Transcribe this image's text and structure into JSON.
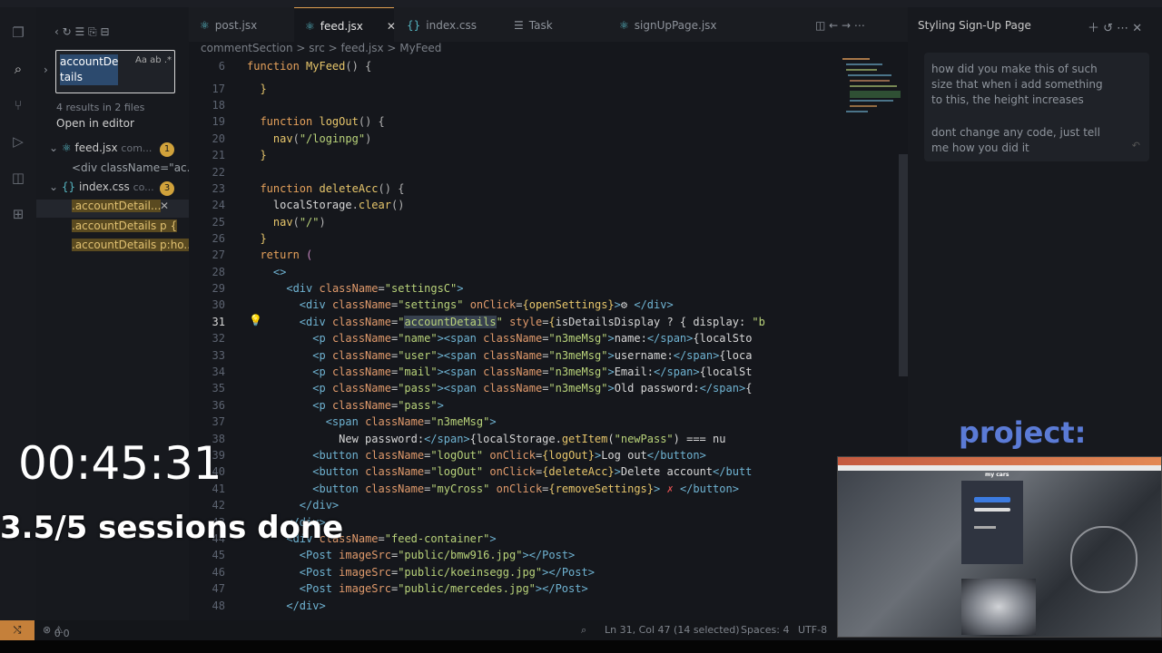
{
  "search": {
    "query_line1": "accountDe",
    "query_line2": "tails",
    "options": "Aa ab .*",
    "results_summary": "4 results in 2 files",
    "open_in_editor": "Open in editor",
    "files": [
      {
        "name": "feed.jsx",
        "path": "com...",
        "count": "1",
        "matches": [
          "<div className=\"ac..."
        ]
      },
      {
        "name": "index.css",
        "path": "co...",
        "count": "3",
        "matches": [
          ".accountDetail...",
          ".accountDetails p {",
          ".accountDetails p:ho..."
        ]
      }
    ]
  },
  "tabs": [
    {
      "label": "post.jsx",
      "active": false
    },
    {
      "label": "feed.jsx",
      "active": true
    },
    {
      "label": "index.css",
      "active": false
    },
    {
      "label": "Task",
      "active": false
    },
    {
      "label": "signUpPage.jsx",
      "active": false
    }
  ],
  "breadcrumb": "commentSection > src > feed.jsx > MyFeed",
  "code_lines": [
    {
      "n": "6",
      "text": "function MyFeed() {"
    },
    {
      "n": "17",
      "text": "  }"
    },
    {
      "n": "18",
      "text": ""
    },
    {
      "n": "19",
      "text": "  function logOut() {"
    },
    {
      "n": "20",
      "text": "    nav(\"/loginpg\")"
    },
    {
      "n": "21",
      "text": "  }"
    },
    {
      "n": "22",
      "text": ""
    },
    {
      "n": "23",
      "text": "  function deleteAcc() {"
    },
    {
      "n": "24",
      "text": "    localStorage.clear()"
    },
    {
      "n": "25",
      "text": "    nav(\"/\")"
    },
    {
      "n": "26",
      "text": "  }"
    },
    {
      "n": "27",
      "text": "  return ("
    },
    {
      "n": "28",
      "text": "    <>"
    },
    {
      "n": "29",
      "text": "      <div className=\"settingsC\">"
    },
    {
      "n": "30",
      "text": "        <div className=\"settings\" onClick={openSettings}>⚙ </div>"
    },
    {
      "n": "31",
      "text": "        <div className=\"accountDetails\" style={isDetailsDisplay ? { display: \"b"
    },
    {
      "n": "32",
      "text": "          <p className=\"name\"><span className=\"n3meMsg\">name:</span>{localSto"
    },
    {
      "n": "33",
      "text": "          <p className=\"user\"><span className=\"n3meMsg\">username:</span>{loca"
    },
    {
      "n": "34",
      "text": "          <p className=\"mail\"><span className=\"n3meMsg\">Email:</span>{localSt"
    },
    {
      "n": "35",
      "text": "          <p className=\"pass\"><span className=\"n3meMsg\">Old password:</span>{"
    },
    {
      "n": "36",
      "text": "          <p className=\"pass\">"
    },
    {
      "n": "37",
      "text": "            <span className=\"n3meMsg\">"
    },
    {
      "n": "38",
      "text": "              New password:</span>{localStorage.getItem(\"newPass\") === nu"
    },
    {
      "n": "39",
      "text": "          <button className=\"logOut\" onClick={logOut}>Log out</button>"
    },
    {
      "n": "40",
      "text": "          <button className=\"logOut\" onClick={deleteAcc}>Delete account</butt"
    },
    {
      "n": "41",
      "text": "          <button className=\"myCross\" onClick={removeSettings}> ✗ </button>"
    },
    {
      "n": "42",
      "text": "        </div>"
    },
    {
      "n": "43",
      "text": "      </div>"
    },
    {
      "n": "44",
      "text": "      <div className=\"feed-container\">"
    },
    {
      "n": "45",
      "text": "        <Post imageSrc=\"public/bmw916.jpg\"></Post>"
    },
    {
      "n": "46",
      "text": "        <Post imageSrc=\"public/koeinsegg.jpg\"></Post>"
    },
    {
      "n": "47",
      "text": "        <Post imageSrc=\"public/mercedes.jpg\"></Post>"
    },
    {
      "n": "48",
      "text": "      </div>"
    }
  ],
  "chat": {
    "title": "Styling Sign-Up Page",
    "message_1": "how did you make this of such size that when i add something to this, the height increases",
    "message_2": "dont change any code, just tell me how you did it"
  },
  "status": {
    "errors": "0",
    "warnings": "0",
    "cursor": "Ln 31, Col 47 (14 selected)",
    "spaces": "Spaces: 4",
    "encoding": "UTF-8"
  },
  "overlay": {
    "timer": "00:45:31",
    "sessions": "3.5/5 sessions done",
    "project_label": "project:",
    "preview_title": "my cars"
  }
}
